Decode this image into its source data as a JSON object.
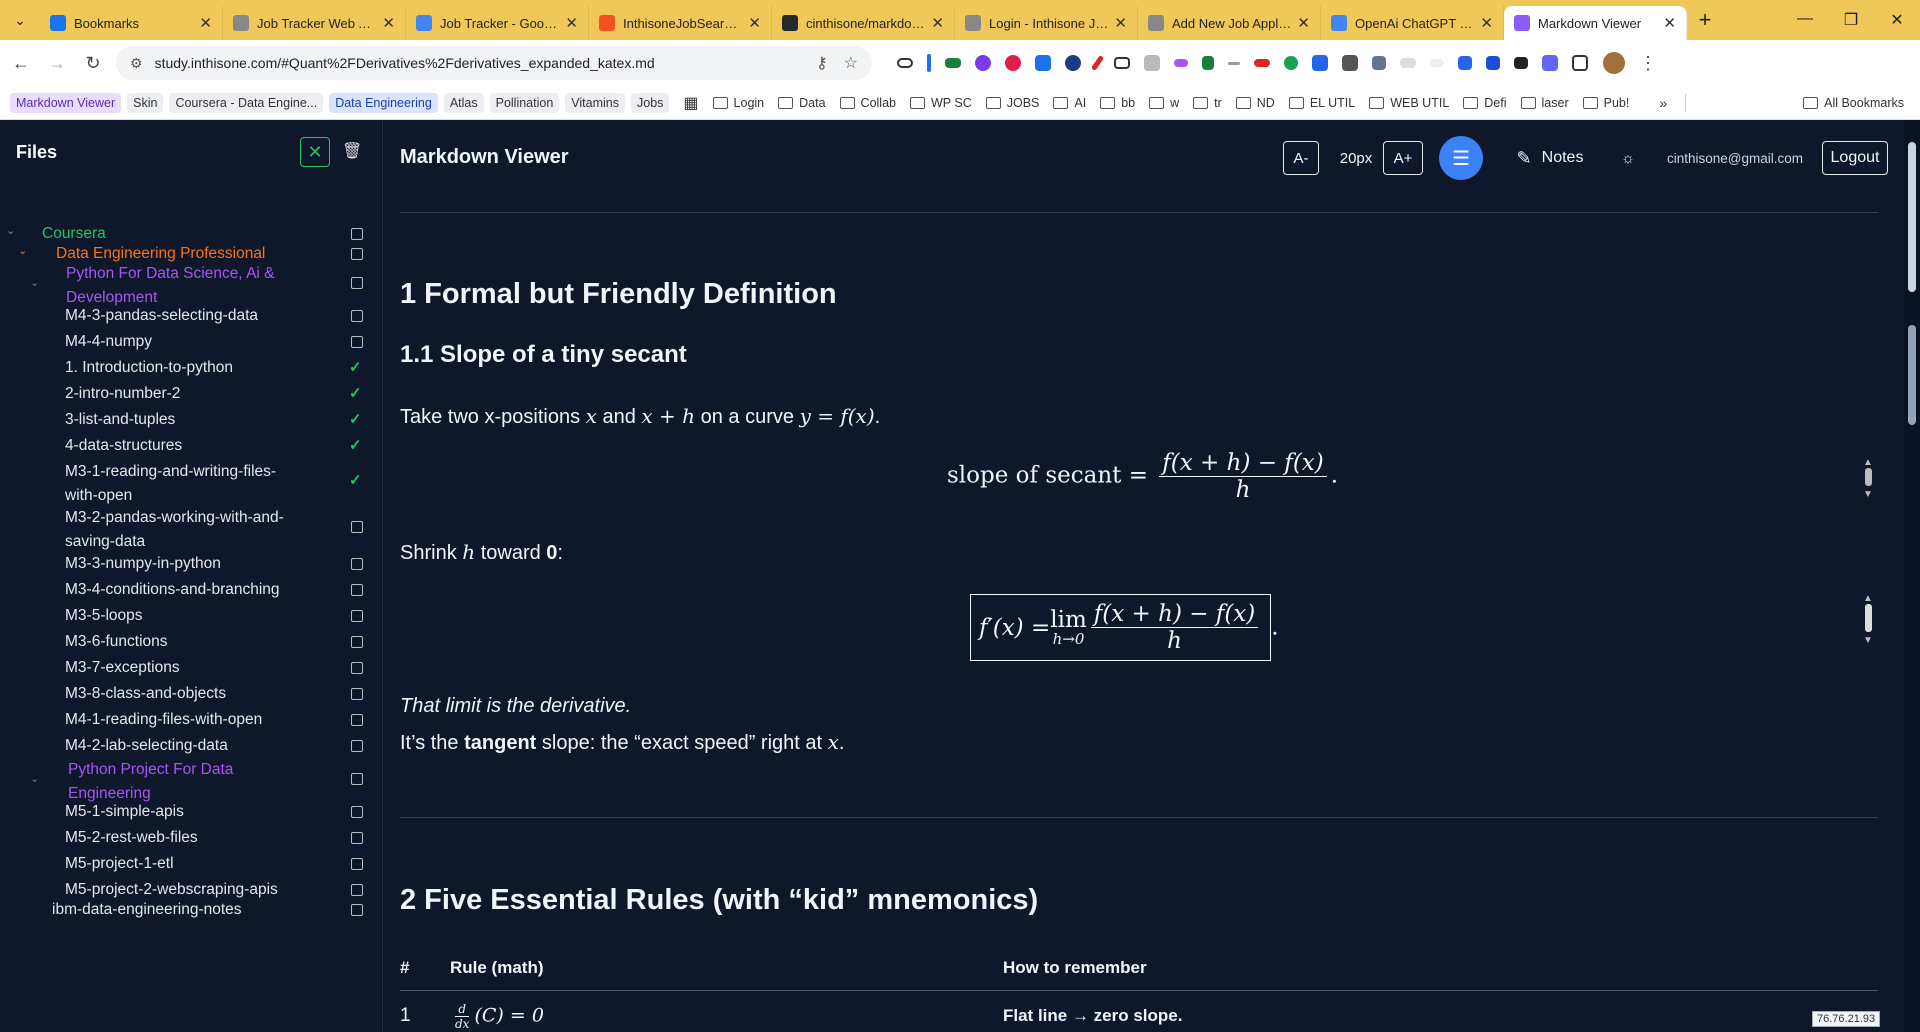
{
  "browser": {
    "tabs": [
      {
        "title": "Bookmarks",
        "color": "#1a73e8"
      },
      {
        "title": "Job Tracker Web App",
        "color": "#888"
      },
      {
        "title": "Job Tracker - Google",
        "color": "#4285f4"
      },
      {
        "title": "InthisoneJobSearch -",
        "color": "#f4511e"
      },
      {
        "title": "cinthisone/markdown",
        "color": "#24292e"
      },
      {
        "title": "Login - Inthisone Job",
        "color": "#888"
      },
      {
        "title": "Add New Job Applica",
        "color": "#888"
      },
      {
        "title": "OpenAi ChatGPT - Go",
        "color": "#4285f4"
      },
      {
        "title": "Markdown Viewer",
        "color": "#8b5cf6"
      }
    ],
    "url": "study.inthisone.com/#Quant%2FDerivatives%2Fderivatives_expanded_katex.md",
    "bookmarks_chips": [
      "Markdown Viewer",
      "Skin",
      "Coursera - Data Engine...",
      "Data Engineering",
      "Atlas",
      "Pollination",
      "Vitamins",
      "Jobs"
    ],
    "bookmark_folders": [
      "Login",
      "Data",
      "Collab",
      "WP SC",
      "JOBS",
      "AI",
      "bb",
      "w",
      "tr",
      "ND",
      "EL UTIL",
      "WEB UTIL",
      "Defi",
      "laser",
      "Pub!"
    ],
    "all_bookmarks": "All Bookmarks",
    "more": "»"
  },
  "sidebar": {
    "title": "Files",
    "close": "✕",
    "trash": "🗑",
    "items": [
      {
        "label": "Coursera",
        "color": "#22c55e",
        "done": false
      },
      {
        "label": "Data Engineering Professional",
        "color": "#f97316",
        "done": false
      },
      {
        "label": "Python For Data Science, Ai &",
        "label2": "Development",
        "color": "#a855f7",
        "done": false
      },
      {
        "label": "M4-3-pandas-selecting-data",
        "done": false
      },
      {
        "label": "M4-4-numpy",
        "done": false
      },
      {
        "label": "1. Introduction-to-python",
        "done": true
      },
      {
        "label": "2-intro-number-2",
        "done": true
      },
      {
        "label": "3-list-and-tuples",
        "done": true
      },
      {
        "label": "4-data-structures",
        "done": true
      },
      {
        "label": "M3-1-reading-and-writing-files-",
        "label2": "with-open",
        "done": true
      },
      {
        "label": "M3-2-pandas-working-with-and-",
        "label2": "saving-data",
        "done": false
      },
      {
        "label": "M3-3-numpy-in-python",
        "done": false
      },
      {
        "label": "M3-4-conditions-and-branching",
        "done": false
      },
      {
        "label": "M3-5-loops",
        "done": false
      },
      {
        "label": "M3-6-functions",
        "done": false
      },
      {
        "label": "M3-7-exceptions",
        "done": false
      },
      {
        "label": "M3-8-class-and-objects",
        "done": false
      },
      {
        "label": "M4-1-reading-files-with-open",
        "done": false
      },
      {
        "label": "M4-2-lab-selecting-data",
        "done": false
      },
      {
        "label": "Python Project For Data",
        "label2": "Engineering",
        "color": "#a855f7",
        "done": false
      },
      {
        "label": "M5-1-simple-apis",
        "done": false
      },
      {
        "label": "M5-2-rest-web-files",
        "done": false
      },
      {
        "label": "M5-project-1-etl",
        "done": false
      },
      {
        "label": "M5-project-2-webscraping-apis",
        "done": false
      },
      {
        "label": "ibm-data-engineering-notes",
        "done": false
      }
    ]
  },
  "header": {
    "title": "Markdown Viewer",
    "font_dec": "A-",
    "font_size": "20px",
    "font_inc": "A+",
    "notes": "Notes",
    "email": "cinthisone@gmail.com",
    "logout": "Logout"
  },
  "content": {
    "h1a": "1  Formal but Friendly Definition",
    "h2a": "1.1   Slope of a tiny secant",
    "p1a": "Take two x-positions ",
    "p1b": " and ",
    "p1c": " on a curve ",
    "p1d": ".",
    "m_x": "x",
    "m_xh": "x + h",
    "m_yfx": "y = f(x)",
    "secant_label": "slope of secant = ",
    "frac_num": "f(x + h) − f(x)",
    "frac_den": "h",
    "p2a": "Shrink ",
    "m_h": "h",
    "p2b": " toward ",
    "p2c": "0",
    "p2d": ":",
    "deriv_lhs": "f′(x) = ",
    "lim": "lim",
    "lim_sub": "h→0",
    "p3": "That limit is the derivative.",
    "p4a": "It’s the ",
    "p4b": "tangent",
    "p4c": " slope: the “exact speed” right at ",
    "p4d": ".",
    "h1b": "2  Five Essential Rules (with “kid” mnemonics)",
    "table": {
      "headers": [
        "#",
        "Rule (math)",
        "How to remember"
      ],
      "row1": [
        "1",
        "(C) = 0",
        "Flat line → zero slope."
      ],
      "row1_frac_num": "d",
      "row1_frac_den": "dx"
    },
    "period": "."
  },
  "ip": "76.76.21.93"
}
